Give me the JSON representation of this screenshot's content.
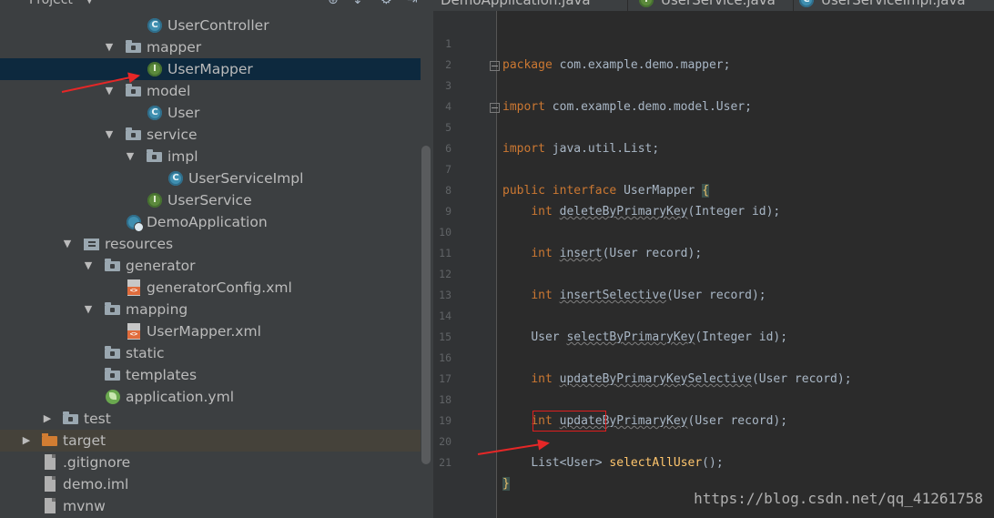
{
  "project_panel": {
    "title": "Project",
    "tree": [
      {
        "label": "UserController",
        "icon": "class-icon"
      },
      {
        "label": "mapper",
        "icon": "folder-icon"
      },
      {
        "label": "UserMapper",
        "icon": "interface-icon"
      },
      {
        "label": "model",
        "icon": "folder-icon"
      },
      {
        "label": "User",
        "icon": "class-icon"
      },
      {
        "label": "service",
        "icon": "folder-icon"
      },
      {
        "label": "impl",
        "icon": "folder-icon"
      },
      {
        "label": "UserServiceImpl",
        "icon": "class-icon"
      },
      {
        "label": "UserService",
        "icon": "interface-icon"
      },
      {
        "label": "DemoApplication",
        "icon": "spring-app-icon"
      },
      {
        "label": "resources",
        "icon": "resources-folder-icon"
      },
      {
        "label": "generator",
        "icon": "folder-icon"
      },
      {
        "label": "generatorConfig.xml",
        "icon": "xml-file-icon"
      },
      {
        "label": "mapping",
        "icon": "folder-icon"
      },
      {
        "label": "UserMapper.xml",
        "icon": "xml-file-icon"
      },
      {
        "label": "static",
        "icon": "folder-icon"
      },
      {
        "label": "templates",
        "icon": "folder-icon"
      },
      {
        "label": "application.yml",
        "icon": "spring-config-icon"
      },
      {
        "label": "test",
        "icon": "folder-icon"
      },
      {
        "label": "target",
        "icon": "excluded-folder-icon"
      },
      {
        "label": ".gitignore",
        "icon": "file-icon"
      },
      {
        "label": "demo.iml",
        "icon": "file-icon"
      },
      {
        "label": "mvnw",
        "icon": "file-icon"
      }
    ]
  },
  "tabs": [
    "DemoApplication.java",
    "UserService.java",
    "UserServiceImpl.java"
  ],
  "editor": {
    "line_numbers": [
      "1",
      "2",
      "3",
      "4",
      "5",
      "6",
      "7",
      "8",
      "9",
      "10",
      "11",
      "12",
      "13",
      "14",
      "15",
      "16",
      "17",
      "18",
      "19",
      "20",
      "21"
    ],
    "code": {
      "l1": {
        "kw": "package",
        "rest": " com.example.demo.mapper;"
      },
      "l3": {
        "kw": "import",
        "rest": " com.example.demo.model.User;"
      },
      "l5": {
        "kw": "import",
        "rest": " java.util.List;"
      },
      "l7": {
        "kw1": "public",
        "kw2": "interface",
        "name": "UserMapper",
        "brace": "{"
      },
      "l8": {
        "type": "int",
        "method": "deleteByPrimaryKey",
        "params": "(Integer id);"
      },
      "l10": {
        "type": "int",
        "method": "insert",
        "params": "(User record);"
      },
      "l12": {
        "type": "int",
        "method": "insertSelective",
        "params": "(User record);"
      },
      "l14": {
        "type": "User",
        "method": "selectByPrimaryKey",
        "params": "(Integer id);"
      },
      "l16": {
        "type": "int",
        "method": "updateByPrimaryKeySelective",
        "params": "(User record);"
      },
      "l18": {
        "type": "int",
        "method": "updateByPrimaryKey",
        "params": "(User record);"
      },
      "l20": {
        "type": "List<User>",
        "method": "selectAllUser",
        "params": "();"
      },
      "l21": {
        "brace": "}"
      }
    }
  },
  "watermark": "https://blog.csdn.net/qq_41261758",
  "colors": {
    "keyword": "#cc7832",
    "method_decl": "#ffc66d",
    "annotation_box": "#e01e1e",
    "selection": "#0d293e"
  }
}
